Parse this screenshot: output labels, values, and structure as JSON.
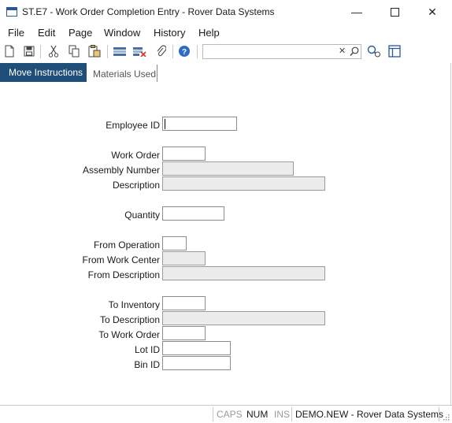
{
  "window": {
    "title": "ST.E7 - Work Order Completion Entry - Rover Data Systems",
    "minimize_glyph": "—",
    "close_glyph": "✕"
  },
  "menubar": {
    "items": [
      "File",
      "Edit",
      "Page",
      "Window",
      "History",
      "Help"
    ]
  },
  "toolbar": {
    "icons": [
      "new-icon",
      "save-icon",
      "cut-icon",
      "copy-icon",
      "paste-icon",
      "insert-row-icon",
      "delete-row-icon",
      "attach-icon",
      "help-icon",
      "search-clear-icon",
      "search-icon",
      "find-icon",
      "layout-icon"
    ],
    "search": {
      "value": "",
      "placeholder": ""
    },
    "clear_glyph": "✕"
  },
  "tabs": {
    "active": "Move Instructions",
    "inactive": "Materials Used"
  },
  "form": {
    "employee_id": {
      "label": "Employee ID",
      "value": ""
    },
    "work_order": {
      "label": "Work Order",
      "value": ""
    },
    "assembly_number": {
      "label": "Assembly Number",
      "value": ""
    },
    "description": {
      "label": "Description",
      "value": ""
    },
    "quantity": {
      "label": "Quantity",
      "value": ""
    },
    "from_operation": {
      "label": "From Operation",
      "value": ""
    },
    "from_work_center": {
      "label": "From Work Center",
      "value": ""
    },
    "from_description": {
      "label": "From Description",
      "value": ""
    },
    "to_inventory": {
      "label": "To Inventory",
      "value": ""
    },
    "to_description": {
      "label": "To Description",
      "value": ""
    },
    "to_work_order": {
      "label": "To Work Order",
      "value": ""
    },
    "lot_id": {
      "label": "Lot ID",
      "value": ""
    },
    "bin_id": {
      "label": "Bin ID",
      "value": ""
    }
  },
  "statusbar": {
    "caps": "CAPS",
    "num": "NUM",
    "ins": "INS",
    "account": "DEMO.NEW - Rover Data Systems"
  },
  "colors": {
    "accent": "#1f4e79",
    "readonly_field": "#ececec",
    "indicator_off": "#9a9a9a",
    "indicator_on": "#1a1a1a"
  }
}
